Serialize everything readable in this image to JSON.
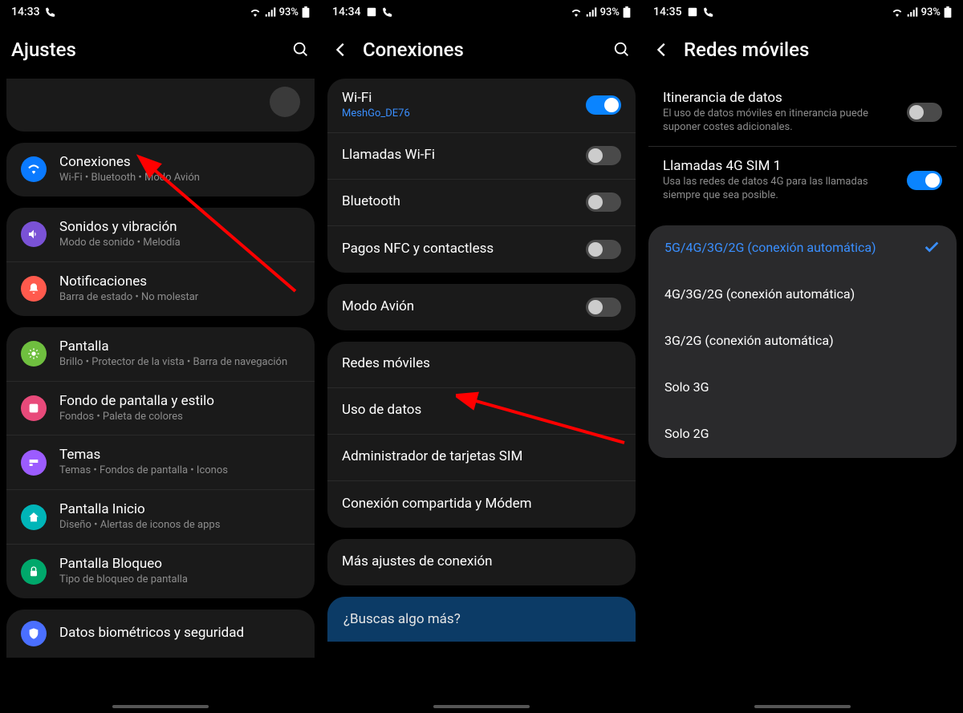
{
  "screens": {
    "s1": {
      "time": "14:33",
      "battery": "93%",
      "title": "Ajustes",
      "items": [
        {
          "title": "Conexiones",
          "sub": "Wi-Fi  •  Bluetooth  •  Modo Avión"
        },
        {
          "title": "Sonidos y vibración",
          "sub": "Modo de sonido  •  Melodía"
        },
        {
          "title": "Notificaciones",
          "sub": "Barra de estado  •  No molestar"
        },
        {
          "title": "Pantalla",
          "sub": "Brillo  •  Protector de la vista  •  Barra de navegación"
        },
        {
          "title": "Fondo de pantalla y estilo",
          "sub": "Fondos  •  Paleta de colores"
        },
        {
          "title": "Temas",
          "sub": "Temas  •  Fondos de pantalla  •  Iconos"
        },
        {
          "title": "Pantalla Inicio",
          "sub": "Diseño  •  Alertas de iconos de apps"
        },
        {
          "title": "Pantalla Bloqueo",
          "sub": "Tipo de bloqueo de pantalla"
        },
        {
          "title": "Datos biométricos y seguridad",
          "sub": ""
        }
      ]
    },
    "s2": {
      "time": "14:34",
      "battery": "93%",
      "title": "Conexiones",
      "rows": {
        "wifi": {
          "title": "Wi-Fi",
          "sub": "MeshGo_DE76",
          "toggle": true
        },
        "wificall": {
          "title": "Llamadas Wi-Fi",
          "toggle": false
        },
        "bt": {
          "title": "Bluetooth",
          "toggle": false
        },
        "nfc": {
          "title": "Pagos NFC y contactless",
          "toggle": false
        },
        "airplane": {
          "title": "Modo Avión",
          "toggle": false
        },
        "mobile": {
          "title": "Redes móviles"
        },
        "data": {
          "title": "Uso de datos"
        },
        "sim": {
          "title": "Administrador de tarjetas SIM"
        },
        "tether": {
          "title": "Conexión compartida y Módem"
        },
        "more": {
          "title": "Más ajustes de conexión"
        }
      },
      "prompt": "¿Buscas algo más?"
    },
    "s3": {
      "time": "14:35",
      "battery": "93%",
      "title": "Redes móviles",
      "roaming": {
        "title": "Itinerancia de datos",
        "sub": "El uso de datos móviles en itinerancia puede suponer costes adicionales.",
        "toggle": false
      },
      "lte": {
        "title": "Llamadas 4G SIM 1",
        "sub": "Usa las redes de datos 4G para las llamadas siempre que sea posible.",
        "toggle": true
      },
      "options": [
        {
          "label": "5G/4G/3G/2G (conexión automática)",
          "selected": true
        },
        {
          "label": "4G/3G/2G (conexión automática)",
          "selected": false
        },
        {
          "label": "3G/2G (conexión automática)",
          "selected": false
        },
        {
          "label": "Solo 3G",
          "selected": false
        },
        {
          "label": "Solo 2G",
          "selected": false
        }
      ]
    }
  }
}
